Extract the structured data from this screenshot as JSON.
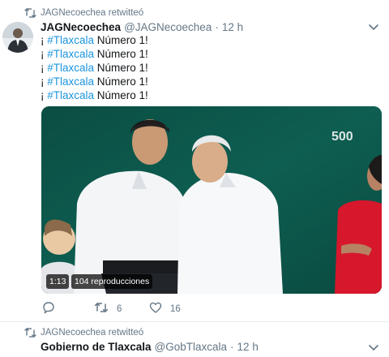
{
  "tweets": [
    {
      "retweet_context": "JAGNecoechea retwitteó",
      "author": {
        "name": "JAGNecoechea",
        "handle": "@JAGNecoechea",
        "dot": "·",
        "time": "12 h"
      },
      "body": {
        "lines": [
          {
            "prefix": "¡ ",
            "hashtag": "#Tlaxcala",
            "suffix": " Número 1!"
          },
          {
            "prefix": "¡ ",
            "hashtag": "#Tlaxcala",
            "suffix": " Número 1!"
          },
          {
            "prefix": "¡ ",
            "hashtag": "#Tlaxcala",
            "suffix": " Número 1!"
          },
          {
            "prefix": "¡ ",
            "hashtag": "#Tlaxcala",
            "suffix": " Número 1!"
          },
          {
            "prefix": "¡ ",
            "hashtag": "#Tlaxcala",
            "suffix": " Número 1!"
          }
        ]
      },
      "media": {
        "duration": "1:13",
        "views": "104 reproducciones",
        "logo_text": "500"
      },
      "actions": {
        "replies": "",
        "retweets": "6",
        "likes": "16"
      }
    },
    {
      "retweet_context": "JAGNecoechea retwitteó",
      "author": {
        "name": "Gobierno de Tlaxcala",
        "handle": "@GobTlaxcala",
        "dot": "·",
        "time": "12 h"
      }
    }
  ],
  "colors": {
    "link": "#1b95e0",
    "secondary_text": "#657786",
    "primary_text": "#14171a"
  },
  "icons": [
    "retweet-icon",
    "chevron-down-icon",
    "reply-icon",
    "like-icon"
  ]
}
